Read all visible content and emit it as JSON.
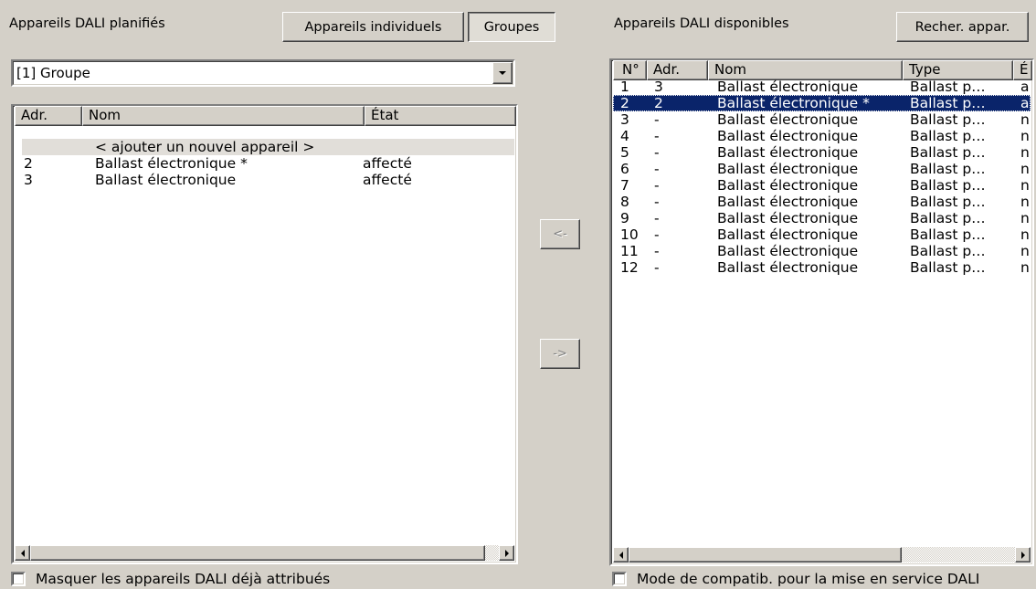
{
  "planned": {
    "title": "Appareils DALI planifiés",
    "btn_individual": "Appareils individuels",
    "btn_groups": "Groupes",
    "group_select_value": "[1] Groupe",
    "columns": [
      "Adr.",
      "Nom",
      "État"
    ],
    "new_device_row": "< ajouter un nouvel appareil >",
    "rows": [
      {
        "adr": "2",
        "nom": "Ballast électronique *",
        "etat": "affecté"
      },
      {
        "adr": "3",
        "nom": "Ballast électronique",
        "etat": "affecté"
      }
    ],
    "hide_assigned_label": "Masquer les appareils DALI déjà attribués"
  },
  "transfer": {
    "to_left": "<-",
    "to_right": "->"
  },
  "available": {
    "title": "Appareils DALI disponibles",
    "search_button": "Recher. appar.",
    "columns": [
      "N°",
      "Adr.",
      "Nom",
      "Type",
      "É"
    ],
    "rows": [
      {
        "n": "1",
        "adr": "3",
        "nom": "Ballast électronique",
        "type": "Ballast p…",
        "e": "a"
      },
      {
        "n": "2",
        "adr": "2",
        "nom": "Ballast électronique *",
        "type": "Ballast p…",
        "e": "a"
      },
      {
        "n": "3",
        "adr": "-",
        "nom": "Ballast électronique",
        "type": "Ballast p…",
        "e": "n"
      },
      {
        "n": "4",
        "adr": "-",
        "nom": "Ballast électronique",
        "type": "Ballast p…",
        "e": "n"
      },
      {
        "n": "5",
        "adr": "-",
        "nom": "Ballast électronique",
        "type": "Ballast p…",
        "e": "n"
      },
      {
        "n": "6",
        "adr": "-",
        "nom": "Ballast électronique",
        "type": "Ballast p…",
        "e": "n"
      },
      {
        "n": "7",
        "adr": "-",
        "nom": "Ballast électronique",
        "type": "Ballast p…",
        "e": "n"
      },
      {
        "n": "8",
        "adr": "-",
        "nom": "Ballast électronique",
        "type": "Ballast p…",
        "e": "n"
      },
      {
        "n": "9",
        "adr": "-",
        "nom": "Ballast électronique",
        "type": "Ballast p…",
        "e": "n"
      },
      {
        "n": "10",
        "adr": "-",
        "nom": "Ballast électronique",
        "type": "Ballast p…",
        "e": "n"
      },
      {
        "n": "11",
        "adr": "-",
        "nom": "Ballast électronique",
        "type": "Ballast p…",
        "e": "n"
      },
      {
        "n": "12",
        "adr": "-",
        "nom": "Ballast électronique",
        "type": "Ballast p…",
        "e": "n"
      }
    ],
    "selected_row": 1,
    "compat_mode_label": "Mode de compatib. pour la mise en service DALI"
  },
  "colors": {
    "face": "#d4d0c8",
    "selection": "#0a246a"
  }
}
